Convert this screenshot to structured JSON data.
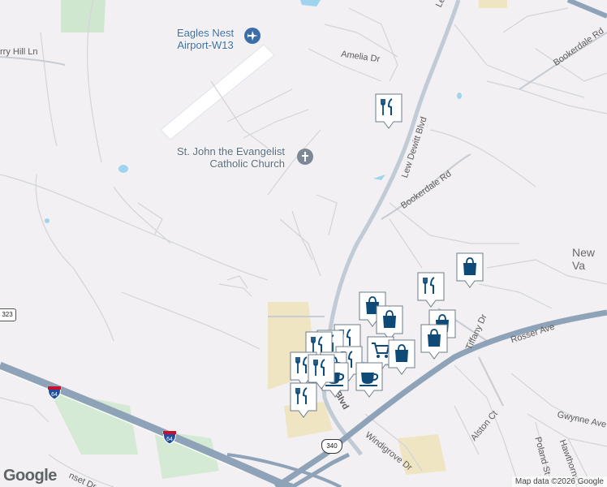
{
  "map": {
    "poi": {
      "airport": "Eagles Nest\nAirport-W13",
      "church": "St. John the Evangelist\nCatholic Church"
    },
    "streets": {
      "lew_dewitt_top": "Lew Dewitt Blvd",
      "lew_dewitt_mid": "Lew Dewitt Blvd",
      "lew_dewitt_bottom": "Blvd",
      "amelia": "Amelia Dr",
      "bookerdale_top": "Bookerdale Rd",
      "bookerdale_mid": "Bookerdale Rd",
      "rosser": "Rosser Ave",
      "tiffany": "Tiffany Dr",
      "windigrove": "Windigrove Dr",
      "alston": "Alston Ct",
      "gwynne": "Gwynne Ave",
      "hawthorne": "Hawthorne Ln",
      "poland": "Poland St",
      "berry_hill": "rry Hill Ln",
      "sunset": "nset Dr"
    },
    "town": "New Va",
    "shields": {
      "route_323": "323",
      "interstate_64_a": "64",
      "interstate_64_b": "64",
      "us_340": "340"
    },
    "google": "Google",
    "attribution": "Map data ©2026 Google",
    "colors": {
      "pin_fill": "#0d4a78",
      "pin_bg": "#ffffff",
      "highway": "#8fa3b8",
      "road": "#c9ccd3",
      "park": "#d5ead5",
      "commercial": "#f0e6c4",
      "water": "#9fd4ef"
    }
  },
  "markers": [
    {
      "type": "restaurant",
      "icon": "fork-knife-icon"
    },
    {
      "type": "shopping",
      "icon": "shopping-bag-icon"
    },
    {
      "type": "restaurant",
      "icon": "fork-knife-icon"
    },
    {
      "type": "shopping",
      "icon": "shopping-bag-icon"
    },
    {
      "type": "shopping",
      "icon": "shopping-bag-icon"
    },
    {
      "type": "shopping",
      "icon": "shopping-bag-icon"
    },
    {
      "type": "shopping",
      "icon": "shopping-bag-icon"
    },
    {
      "type": "restaurant",
      "icon": "fork-knife-icon"
    },
    {
      "type": "restaurant",
      "icon": "fork-knife-icon"
    },
    {
      "type": "restaurant",
      "icon": "fork-knife-icon"
    },
    {
      "type": "grocery",
      "icon": "shopping-cart-icon"
    },
    {
      "type": "shopping",
      "icon": "shopping-bag-icon"
    },
    {
      "type": "restaurant",
      "icon": "fork-knife-icon"
    },
    {
      "type": "restaurant",
      "icon": "fork-knife-icon"
    },
    {
      "type": "shopping",
      "icon": "shopping-bag-icon"
    },
    {
      "type": "restaurant",
      "icon": "fork-knife-icon"
    },
    {
      "type": "cafe",
      "icon": "coffee-cup-icon"
    },
    {
      "type": "cafe",
      "icon": "coffee-cup-icon"
    },
    {
      "type": "restaurant",
      "icon": "fork-knife-icon"
    }
  ]
}
